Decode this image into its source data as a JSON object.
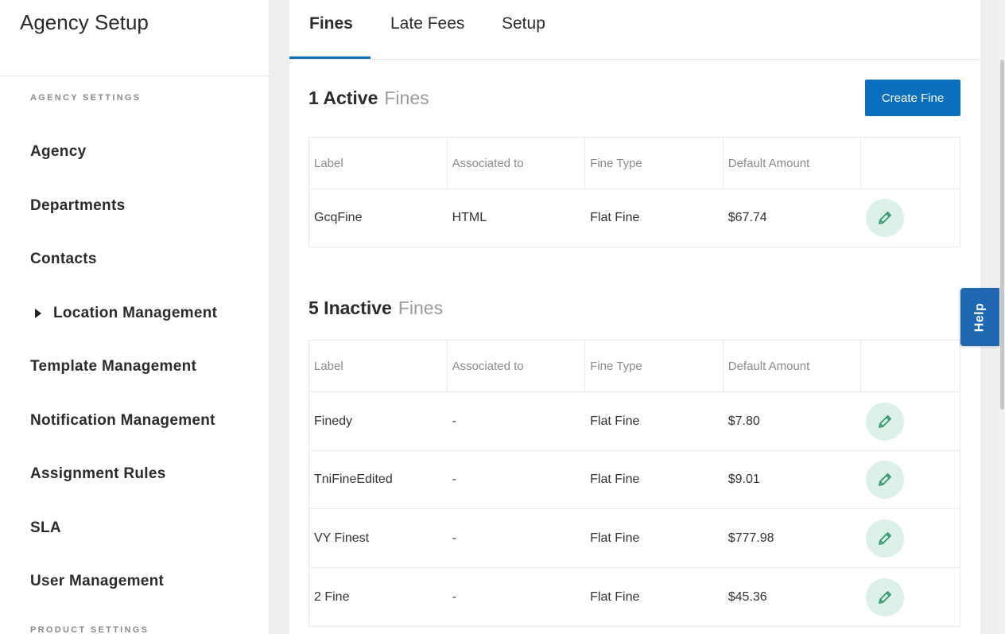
{
  "sidebar": {
    "title": "Agency Setup",
    "section_agency": "AGENCY SETTINGS",
    "section_product": "PRODUCT SETTINGS",
    "items": [
      {
        "label": "Agency"
      },
      {
        "label": "Departments"
      },
      {
        "label": "Contacts"
      },
      {
        "label": "Location Management"
      },
      {
        "label": "Template Management"
      },
      {
        "label": "Notification Management"
      },
      {
        "label": "Assignment Rules"
      },
      {
        "label": "SLA"
      },
      {
        "label": "User Management"
      }
    ]
  },
  "tabs": [
    {
      "label": "Fines",
      "active": true
    },
    {
      "label": "Late Fees"
    },
    {
      "label": "Setup"
    }
  ],
  "active_section": {
    "count": "1 Active",
    "suffix": "Fines",
    "create_label": "Create Fine"
  },
  "inactive_section": {
    "count": "5 Inactive",
    "suffix": "Fines"
  },
  "table_headers": [
    "Label",
    "Associated to",
    "Fine Type",
    "Default Amount"
  ],
  "active_rows": [
    {
      "label": "GcqFine",
      "associated": "HTML",
      "type": "Flat Fine",
      "amount": "$67.74"
    }
  ],
  "inactive_rows": [
    {
      "label": "Finedy",
      "associated": "-",
      "type": "Flat Fine",
      "amount": "$7.80"
    },
    {
      "label": "TniFineEdited",
      "associated": "-",
      "type": "Flat Fine",
      "amount": "$9.01"
    },
    {
      "label": "VY Finest",
      "associated": "-",
      "type": "Flat Fine",
      "amount": "$777.98"
    },
    {
      "label": "2 Fine",
      "associated": "-",
      "type": "Flat Fine",
      "amount": "$45.36"
    }
  ],
  "help_label": "Help",
  "icons": {
    "edit": "pencil-icon",
    "expand": "caret-right-icon"
  },
  "colors": {
    "accent": "#0a6fbd",
    "edit_bg": "#dbf0e6",
    "edit_icon": "#2e9a6a",
    "help_bg": "#1f68b1"
  }
}
